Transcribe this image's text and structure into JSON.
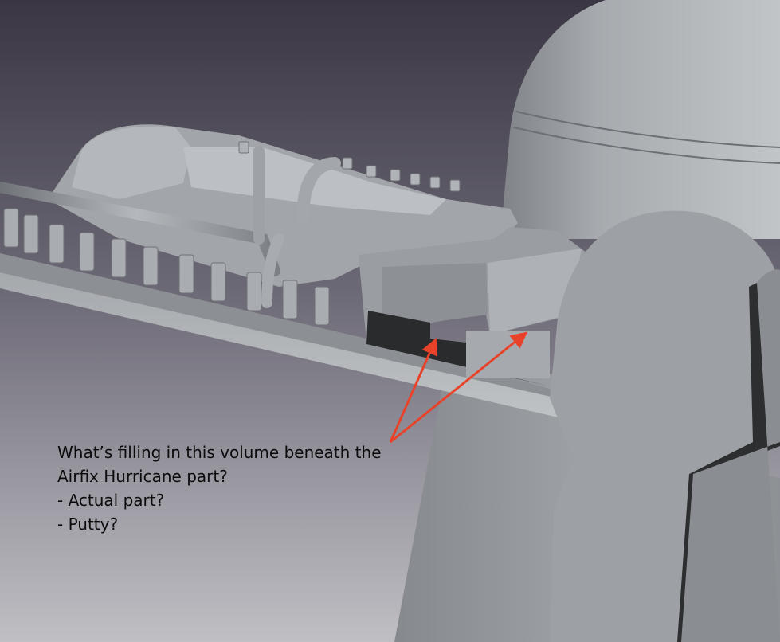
{
  "annotation": {
    "lines": [
      "What’s filling in this volume beneath the",
      "Airfix Hurricane part?",
      "- Actual part?",
      "- Putty?"
    ],
    "arrow_color": "#e8432a"
  },
  "palette": {
    "bg_top": "#3b3744",
    "bg_bottom": "#bdbcc2",
    "model_light": "#b9bcc0",
    "model_mid": "#979a9f",
    "model_dark": "#6d7075",
    "shadow": "#242526"
  }
}
